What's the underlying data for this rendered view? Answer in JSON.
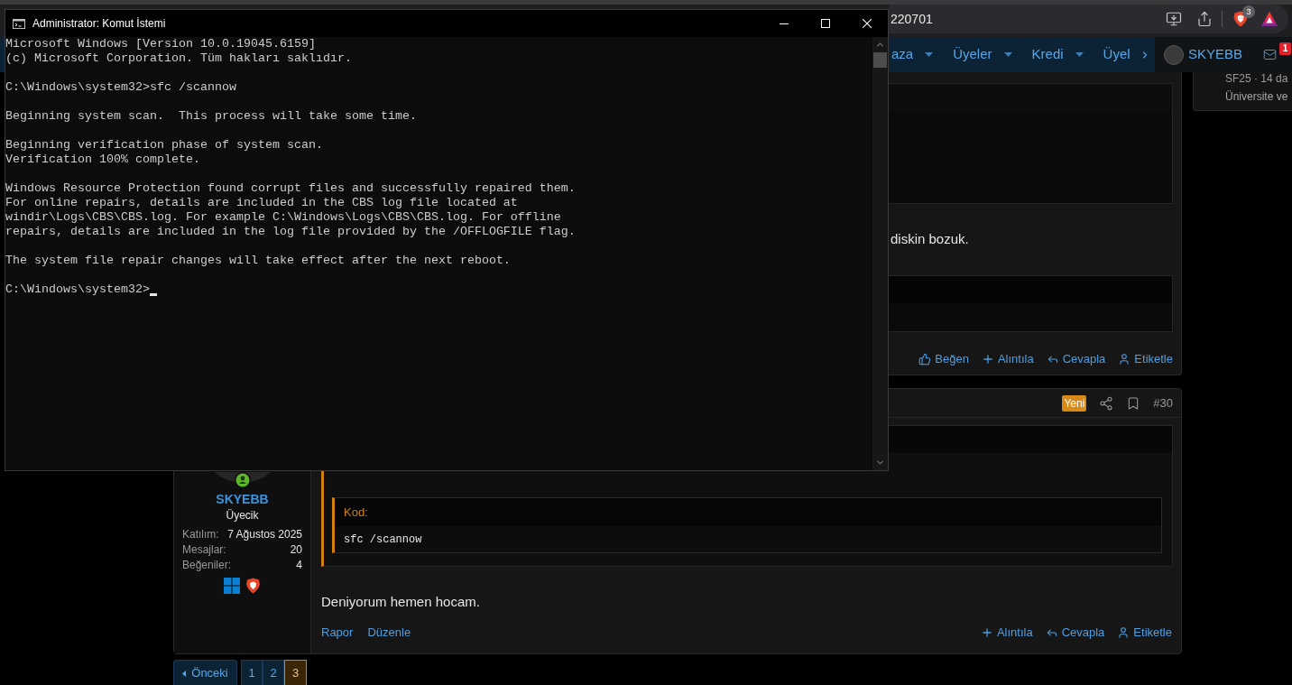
{
  "browser": {
    "url_fragment": "220701",
    "shield_badge": "3"
  },
  "nav": {
    "items": [
      {
        "label": "aza",
        "dropdown": true
      },
      {
        "label": "Üyeler",
        "dropdown": true
      },
      {
        "label": "Kredi",
        "dropdown": true
      },
      {
        "label": "Üyel",
        "dropdown": false
      }
    ],
    "username": "SKYEBB",
    "alert_badge": "1"
  },
  "sidebar_card": {
    "lines": [
      "SF25 · 14 da",
      "Üniversite ve"
    ]
  },
  "post_above": {
    "text": "diskin bozuk.",
    "actions": [
      {
        "kind": "like",
        "label": "Beğen"
      },
      {
        "kind": "quote",
        "label": "Alıntıla"
      },
      {
        "kind": "reply",
        "label": "Cevapla"
      },
      {
        "kind": "tag",
        "label": "Etiketle"
      }
    ]
  },
  "post": {
    "badge": "Yeni",
    "number": "#30",
    "author": {
      "name": "SKYEBB",
      "title": "Üyecik",
      "online": true,
      "stats": [
        {
          "label": "Katılım:",
          "value": "7 Ağustos 2025"
        },
        {
          "label": "Mesajlar:",
          "value": "20"
        },
        {
          "label": "Beğeniler:",
          "value": "4"
        }
      ]
    },
    "code": {
      "label": "Kod:",
      "text": "sfc /scannow"
    },
    "text": "Deniyorum hemen hocam.",
    "left_actions": [
      "Rapor",
      "Düzenle"
    ],
    "actions": [
      {
        "kind": "quote",
        "label": "Alıntıla"
      },
      {
        "kind": "reply",
        "label": "Cevapla"
      },
      {
        "kind": "tag",
        "label": "Etiketle"
      }
    ]
  },
  "pagination": {
    "previous": "Önceki",
    "pages": [
      {
        "label": "1",
        "selected": false
      },
      {
        "label": "2",
        "selected": false
      },
      {
        "label": "3",
        "selected": true
      }
    ]
  },
  "terminal": {
    "title": "Administrator: Komut İstemi",
    "blocks": [
      [
        "Microsoft Windows [Version 10.0.19045.6159]",
        "(c) Microsoft Corporation. Tüm hakları saklıdır."
      ],
      [
        "C:\\Windows\\system32>sfc /scannow"
      ],
      [
        "Beginning system scan.  This process will take some time."
      ],
      [
        "Beginning verification phase of system scan.",
        "Verification 100% complete."
      ],
      [
        "Windows Resource Protection found corrupt files and successfully repaired them.",
        "For online repairs, details are included in the CBS log file located at",
        "windir\\Logs\\CBS\\CBS.log. For example C:\\Windows\\Logs\\CBS\\CBS.log. For offline",
        "repairs, details are included in the log file provided by the /OFFLOGFILE flag."
      ],
      [
        "The system file repair changes will take effect after the next reboot."
      ]
    ],
    "prompt": "C:\\Windows\\system32>",
    "cursor": true
  }
}
